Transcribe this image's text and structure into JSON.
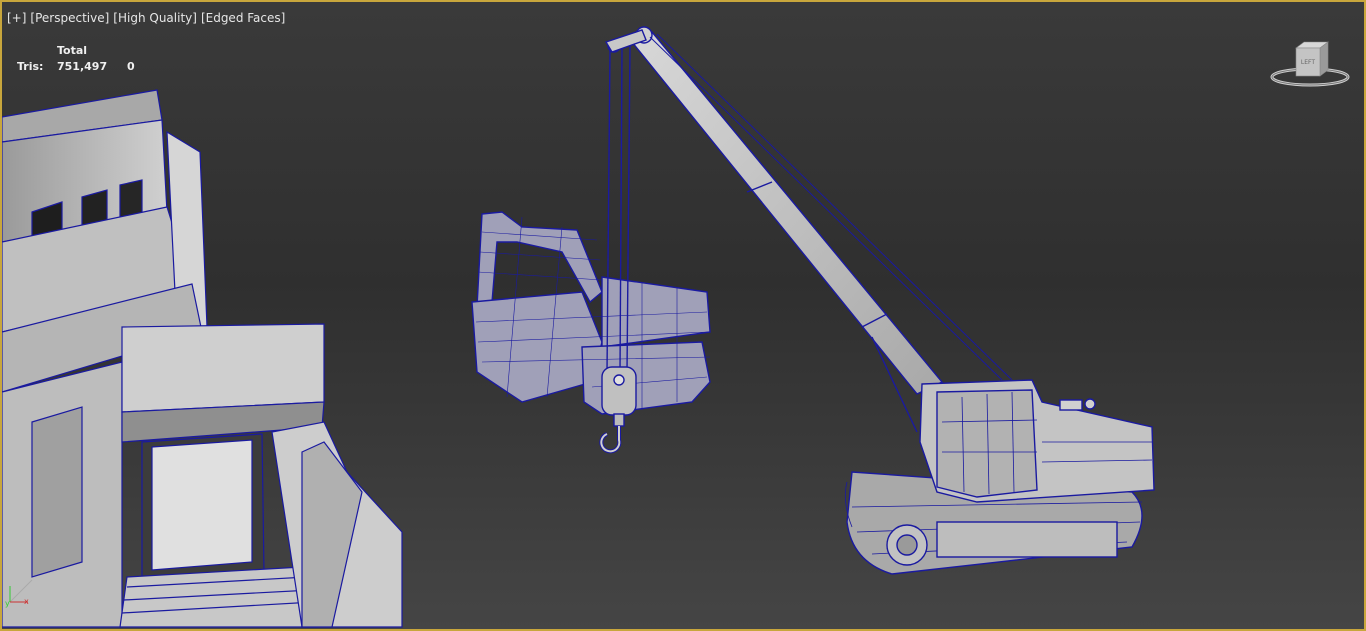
{
  "viewport": {
    "menu": {
      "plus": "[+]",
      "view": "[Perspective]",
      "shading": "[High Quality]",
      "faces": "[Edged Faces]"
    },
    "stats": {
      "header": "Total",
      "tris_label": "Tris:",
      "tris_total": "751,497",
      "tris_selected": "0"
    },
    "viewcube": {
      "face_label": "LEFT"
    },
    "axis_gizmo": {
      "y": "y",
      "x": "x"
    },
    "colors": {
      "frame": "#c8a63c",
      "wire": "#1a1aa0",
      "mesh_fill": "#b8b8b8"
    }
  }
}
